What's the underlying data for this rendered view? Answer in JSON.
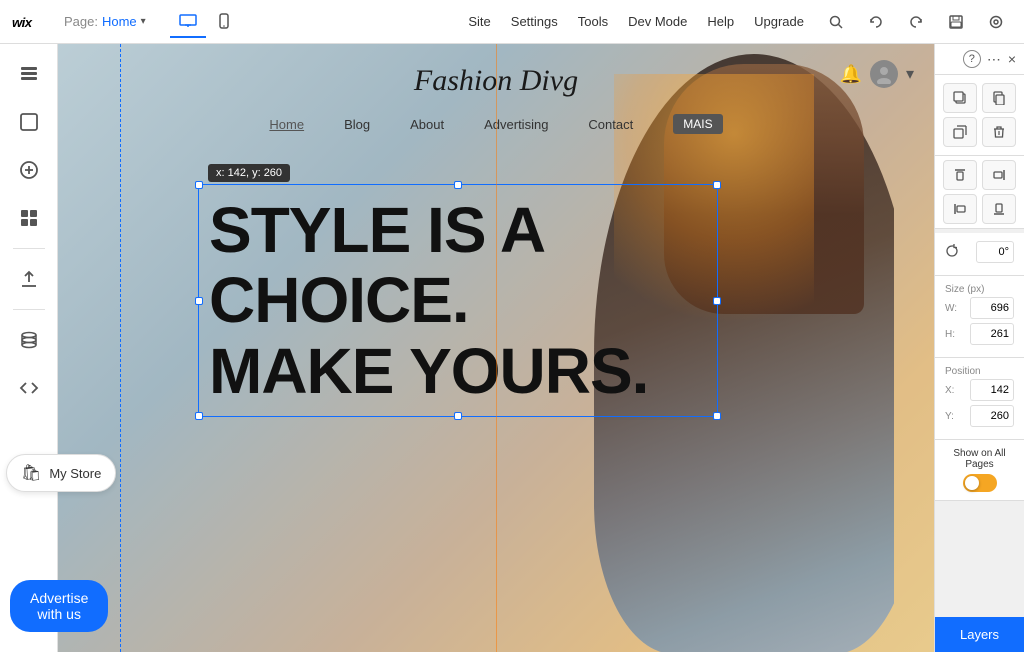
{
  "toolbar": {
    "wix_logo": "Wix",
    "page_label": "Page:",
    "page_name": "Home",
    "desktop_icon": "🖥",
    "mobile_icon": "📱",
    "site_label": "Site",
    "settings_label": "Settings",
    "tools_label": "Tools",
    "dev_mode_label": "Dev Mode",
    "help_label": "Help",
    "upgrade_label": "Upgrade",
    "search_icon": "🔍",
    "undo_icon": "↩",
    "redo_icon": "↪",
    "save_icon": "💾",
    "preview_icon": "👁"
  },
  "left_sidebar": {
    "add_section_icon": "≡",
    "add_element_icon": "⬜",
    "add_app_icon": "+",
    "widgets_icon": "⊞",
    "upload_icon": "☁",
    "database_icon": "🗄",
    "code_icon": "✒",
    "my_store_label": "My Store",
    "advertise_label": "Advertise with us"
  },
  "site": {
    "title": "Fashion Divg",
    "nav_items": [
      "Home",
      "Blog",
      "About",
      "Advertising",
      "Contact",
      "MAIS"
    ],
    "hero_headline": "STYLE IS A CHOICE. MAKE YOURS.",
    "coord_tooltip": "x: 142, y: 260"
  },
  "right_panel": {
    "help_label": "?",
    "dots_label": "⋯",
    "close_label": "×",
    "icons": {
      "copy": "⧉",
      "paste_style": "⧈",
      "duplicate": "⎘",
      "delete": "🗑",
      "align_top": "⬆",
      "align_right": "➡",
      "align_center": "⬌",
      "align_bottom": "⬇"
    },
    "rotate_section": {
      "label": "",
      "angle_value": "0°"
    },
    "size_section": {
      "label": "Size (px)",
      "w_label": "W:",
      "w_value": "696",
      "h_label": "H:",
      "h_value": "261"
    },
    "position_section": {
      "label": "Position",
      "x_label": "X:",
      "x_value": "142",
      "y_label": "Y:",
      "y_value": "260"
    },
    "show_all_pages": {
      "label": "Show on All Pages"
    },
    "layers_btn": "Layers"
  }
}
